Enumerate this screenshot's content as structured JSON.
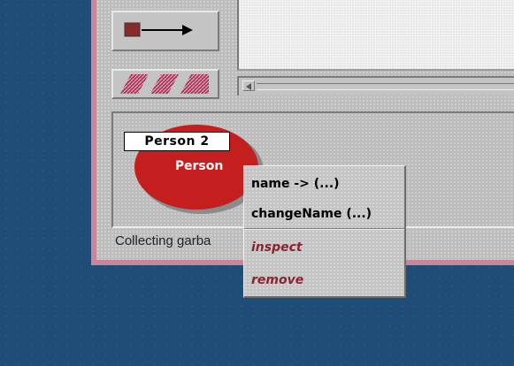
{
  "desktop": {
    "background_color": "#1f4d78"
  },
  "window": {
    "border_color": "#c9869a"
  },
  "toolbar": {
    "connection_tool_icon": "arrow-connector-icon",
    "pattern_tool_icon": "hatch-pattern-icon"
  },
  "diagram": {
    "object": {
      "instance_name": "Person 2",
      "class_name": "Person",
      "fill_color": "#c41e1e"
    }
  },
  "status_bar": {
    "text": "Collecting garba"
  },
  "context_menu": {
    "items": [
      {
        "label": "name -> (...)"
      },
      {
        "label": "changeName (...)"
      },
      {
        "label": "inspect"
      },
      {
        "label": "remove"
      }
    ],
    "system_item_color": "#8a2530"
  }
}
